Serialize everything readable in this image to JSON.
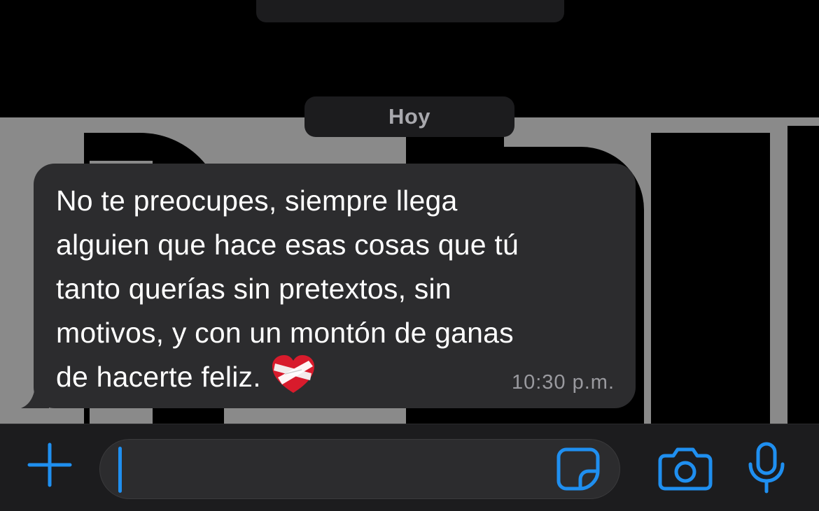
{
  "chat": {
    "date_separator": "Hoy",
    "messages": [
      {
        "text": "No te preocupes, siempre llega\nalguien que hace esas cosas que tú\ntanto querías sin pretextos, sin\nmotivos, y con un montón de ganas\nde hacerte feliz.",
        "emoji": "mending-heart",
        "time": "10:30 p.m.",
        "direction": "incoming"
      }
    ]
  },
  "composer": {
    "value": "",
    "icons": {
      "plus": "plus-icon",
      "sticker": "sticker-icon",
      "camera": "camera-icon",
      "mic": "microphone-icon"
    }
  },
  "colors": {
    "accent": "#1f8ff0",
    "bubble": "#2c2c2e",
    "bar": "#1c1c1e",
    "wallpaper_gray": "#8a8a8a"
  }
}
